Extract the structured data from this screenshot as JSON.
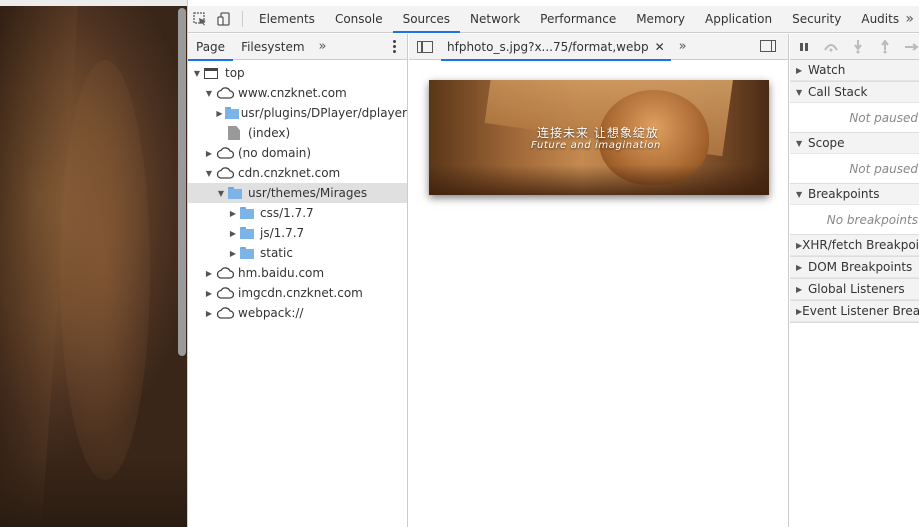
{
  "main_tabs": [
    "Elements",
    "Console",
    "Sources",
    "Network",
    "Performance",
    "Memory",
    "Application",
    "Security",
    "Audits"
  ],
  "main_tab_active": "Sources",
  "main_more": "»",
  "navigator": {
    "tabs": [
      "Page",
      "Filesystem"
    ],
    "more": "»",
    "tree": [
      {
        "label": "top",
        "arrow": "▼",
        "icon": "frame",
        "indent": 0
      },
      {
        "label": "www.cnzknet.com",
        "arrow": "▼",
        "icon": "cloud",
        "indent": 1
      },
      {
        "label": "usr/plugins/DPlayer/dplayer",
        "arrow": "▶",
        "icon": "folder",
        "indent": 2
      },
      {
        "label": "(index)",
        "arrow": "",
        "icon": "file",
        "indent": 2
      },
      {
        "label": "(no domain)",
        "arrow": "▶",
        "icon": "cloud",
        "indent": 1
      },
      {
        "label": "cdn.cnzknet.com",
        "arrow": "▼",
        "icon": "cloud",
        "indent": 1
      },
      {
        "label": "usr/themes/Mirages",
        "arrow": "▼",
        "icon": "folder",
        "indent": 2,
        "selected": true
      },
      {
        "label": "css/1.7.7",
        "arrow": "▶",
        "icon": "folder",
        "indent": 3
      },
      {
        "label": "js/1.7.7",
        "arrow": "▶",
        "icon": "folder",
        "indent": 3
      },
      {
        "label": "static",
        "arrow": "▶",
        "icon": "folder",
        "indent": 3
      },
      {
        "label": "hm.baidu.com",
        "arrow": "▶",
        "icon": "cloud",
        "indent": 1
      },
      {
        "label": "imgcdn.cnzknet.com",
        "arrow": "▶",
        "icon": "cloud",
        "indent": 1
      },
      {
        "label": "webpack://",
        "arrow": "▶",
        "icon": "cloud",
        "indent": 1
      }
    ]
  },
  "editor": {
    "file_tab": "hfphoto_s.jpg?x...75/format,webp",
    "close": "✕",
    "more": "»",
    "preview_text_cn": "连接未来 让想象绽放",
    "preview_text_en": "Future and imagination"
  },
  "debugger": {
    "sections": [
      {
        "title": "Watch",
        "body": ""
      },
      {
        "title": "Call Stack",
        "body": "Not paused"
      },
      {
        "title": "Scope",
        "body": "Not paused"
      },
      {
        "title": "Breakpoints",
        "body": "No breakpoints"
      },
      {
        "title": "XHR/fetch Breakpoints",
        "body": ""
      },
      {
        "title": "DOM Breakpoints",
        "body": ""
      },
      {
        "title": "Global Listeners",
        "body": ""
      },
      {
        "title": "Event Listener Breakpoints",
        "body": ""
      }
    ]
  },
  "colors": {
    "accent": "#1a73e8",
    "folder": "#7cb4e8",
    "toolbar": "#f3f3f3"
  }
}
